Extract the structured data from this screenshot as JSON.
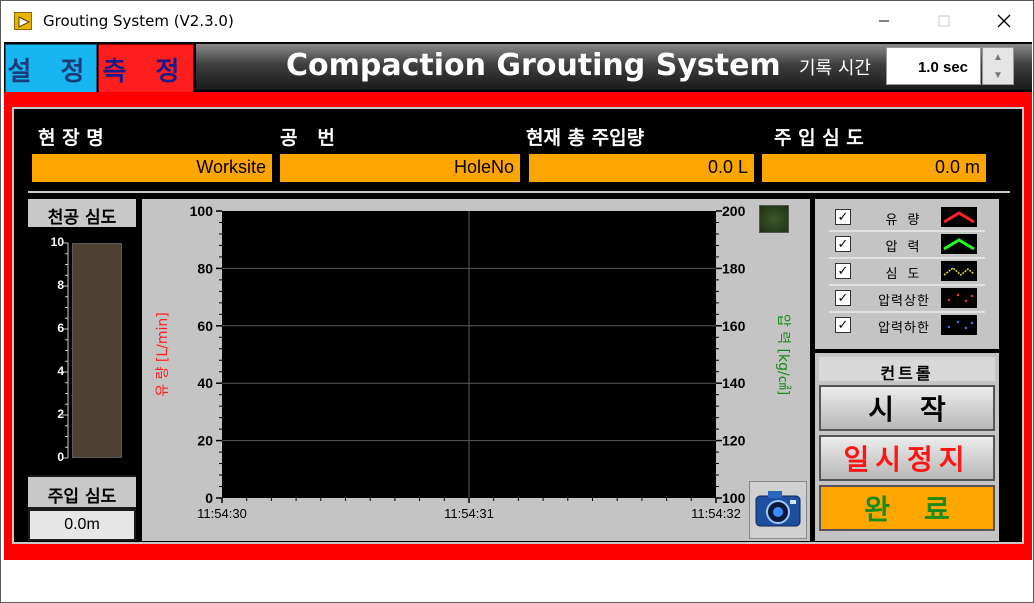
{
  "window": {
    "title": "Grouting System (V2.3.0)"
  },
  "tabs": [
    {
      "label": "설 정",
      "color": "#18b6f0"
    },
    {
      "label": "측 정",
      "color": "#ff1e1e"
    }
  ],
  "header": {
    "title": "Compaction Grouting System",
    "record_time_label": "기록 시간",
    "record_time_value": "1.0 sec"
  },
  "info": {
    "site_name_label": "현 장 명",
    "site_name_value": "Worksite",
    "hole_label": "공   번",
    "hole_value": "HoleNo",
    "total_injection_label": "현재 총 주입량",
    "total_injection_value": "0.0 L",
    "injection_depth_label": "주 입 심 도",
    "injection_depth_value": "0.0 m"
  },
  "depth_panel": {
    "title": "천공 심도",
    "ticks": [
      "10",
      "8",
      "6",
      "4",
      "2",
      "0"
    ],
    "label": "주입 심도",
    "value": "0.0m"
  },
  "chart_data": {
    "type": "line",
    "x_ticks": [
      "11:54:30",
      "11:54:31",
      "11:54:32"
    ],
    "y_left": {
      "label": "유 량 [L/min]",
      "ticks": [
        "100",
        "80",
        "60",
        "40",
        "20",
        "0"
      ],
      "ylim": [
        0,
        100
      ],
      "color": "#ff2020"
    },
    "y_right": {
      "label": "압 력 [kg/㎠]",
      "ticks": [
        "200",
        "180",
        "160",
        "140",
        "120",
        "100"
      ],
      "ylim": [
        100,
        200
      ],
      "color": "#1a8a1a"
    },
    "series": [],
    "grid": true
  },
  "legend": {
    "items": [
      {
        "label": "유  량",
        "checked": true,
        "color": "#ff2020"
      },
      {
        "label": "압  력",
        "checked": true,
        "color": "#20ff20"
      },
      {
        "label": "심  도",
        "checked": true,
        "color": "#e8e020"
      },
      {
        "label": "압력상한",
        "checked": true,
        "color": "#ff3030"
      },
      {
        "label": "압력하한",
        "checked": true,
        "color": "#3080ff"
      }
    ]
  },
  "control": {
    "title": "컨트롤",
    "start_label": "시작",
    "pause_label": "일시정지",
    "done_label": "완료"
  }
}
